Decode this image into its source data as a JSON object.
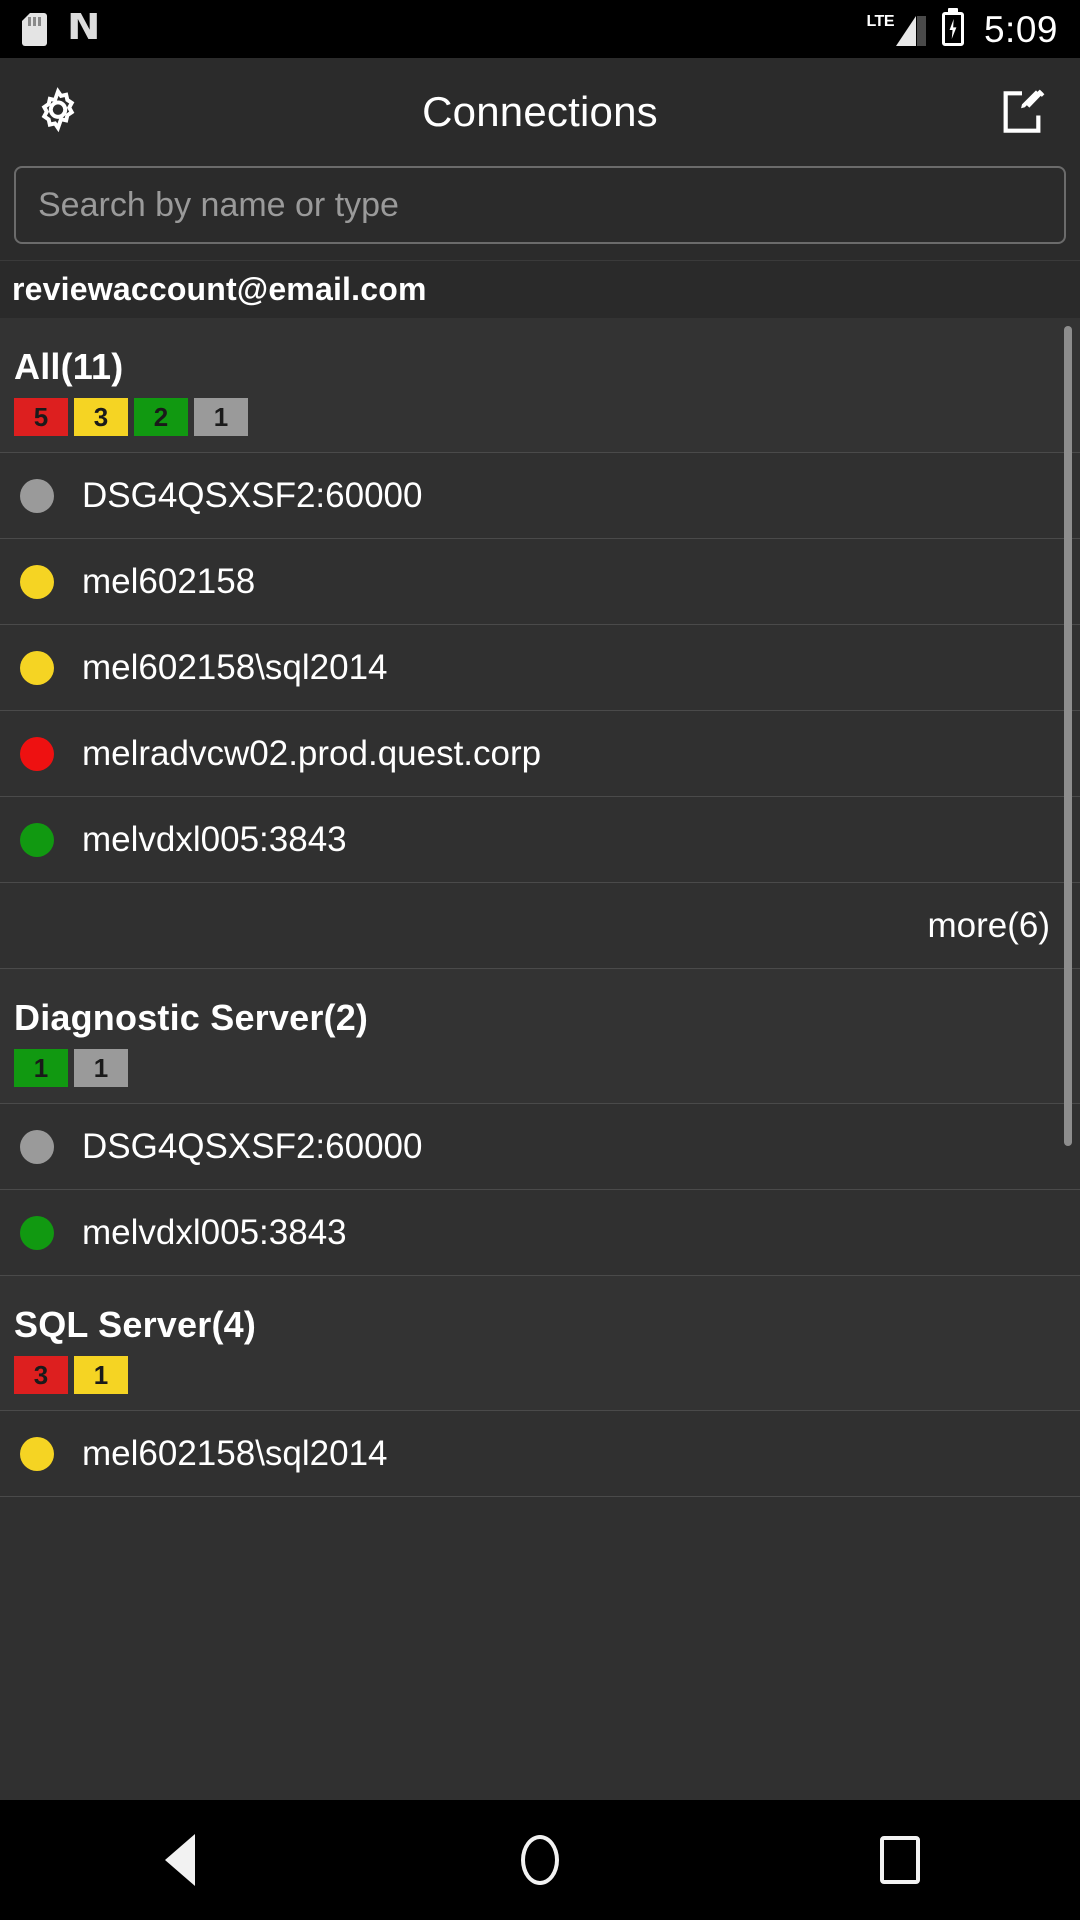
{
  "status_bar": {
    "icons": [
      "sdcard-icon",
      "nfc-n-icon"
    ],
    "network_label": "LTE",
    "battery": "charging",
    "time": "5:09"
  },
  "appbar": {
    "settings_icon": "gear-icon",
    "title": "Connections",
    "compose_icon": "compose-icon"
  },
  "search": {
    "value": "",
    "placeholder": "Search by name or type"
  },
  "account": {
    "email": "reviewaccount@email.com"
  },
  "colors": {
    "red": "#dd1f1f",
    "yellow": "#f5d423",
    "green": "#119911",
    "gray": "#9a9a9a",
    "background": "#303030",
    "appbar": "#2b2b2b"
  },
  "sections": [
    {
      "title": "All(11)",
      "badges": [
        {
          "count": "5",
          "color": "#dd1f1f"
        },
        {
          "count": "3",
          "color": "#f5d423"
        },
        {
          "count": "2",
          "color": "#119911"
        },
        {
          "count": "1",
          "color": "#9a9a9a"
        }
      ],
      "rows": [
        {
          "name": "DSG4QSXSF2:60000",
          "status": "gray",
          "color": "#9a9a9a"
        },
        {
          "name": "mel602158",
          "status": "yellow",
          "color": "#f5d423"
        },
        {
          "name": "mel602158\\sql2014",
          "status": "yellow",
          "color": "#f5d423"
        },
        {
          "name": "melradvcw02.prod.quest.corp",
          "status": "red",
          "color": "#ee1111"
        },
        {
          "name": "melvdxl005:3843",
          "status": "green",
          "color": "#119911"
        }
      ],
      "more_label": "more(6)"
    },
    {
      "title": "Diagnostic Server(2)",
      "badges": [
        {
          "count": "1",
          "color": "#119911"
        },
        {
          "count": "1",
          "color": "#9a9a9a"
        }
      ],
      "rows": [
        {
          "name": "DSG4QSXSF2:60000",
          "status": "gray",
          "color": "#9a9a9a"
        },
        {
          "name": "melvdxl005:3843",
          "status": "green",
          "color": "#119911"
        }
      ],
      "more_label": ""
    },
    {
      "title": "SQL Server(4)",
      "badges": [
        {
          "count": "3",
          "color": "#dd1f1f"
        },
        {
          "count": "1",
          "color": "#f5d423"
        }
      ],
      "rows": [
        {
          "name": "mel602158\\sql2014",
          "status": "yellow",
          "color": "#f5d423"
        }
      ],
      "more_label": ""
    }
  ],
  "navbar": {
    "back": "back-icon",
    "home": "home-icon",
    "recents": "recents-icon"
  }
}
